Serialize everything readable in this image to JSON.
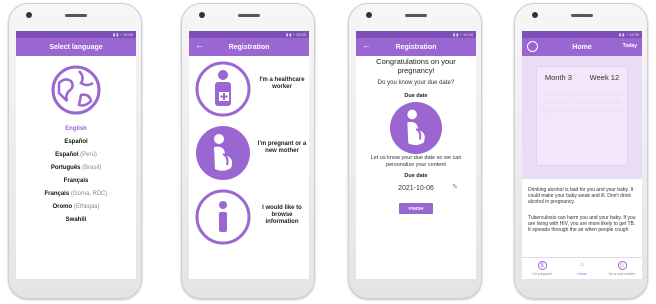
{
  "phone1": {
    "title": "Select language",
    "languages": [
      {
        "name": "English",
        "region": "",
        "selected": true
      },
      {
        "name": "Español",
        "region": ""
      },
      {
        "name": "Español",
        "region": "(Perú)"
      },
      {
        "name": "Português",
        "region": "(Brasil)"
      },
      {
        "name": "Français",
        "region": ""
      },
      {
        "name": "Français",
        "region": "(Goma, RDC)"
      },
      {
        "name": "Oromo",
        "region": "(Ethiopia)"
      },
      {
        "name": "Swahili",
        "region": ""
      }
    ]
  },
  "phone2": {
    "title": "Registration",
    "back": "←",
    "options": [
      {
        "label": "I'm a healthcare worker",
        "icon": "healthcare-worker-icon"
      },
      {
        "label": "I'm pregnant or a new mother",
        "icon": "pregnant-mother-icon"
      },
      {
        "label": "I would like to browse information",
        "icon": "info-icon"
      }
    ]
  },
  "phone3": {
    "title": "Registration",
    "back": "←",
    "congrats": "Congratulations on your pregnancy!",
    "question": "Do you know your due date?",
    "due_heading": "Due date",
    "let_us_know": "Let us know your due date so we can personalize your content",
    "due_label": "Due date",
    "due_value": "2021-10-06",
    "finish": "FINISH"
  },
  "phone4": {
    "title": "Home",
    "today": "Today",
    "month": "Month 3",
    "week": "Week 12",
    "baby_text": "Your baby is about the size of a lime! He can close his fingers and curl his toes now.",
    "para1": "Drinking alcohol is bad for you and your baby. It could make your baby weak and ill. Don't drink alcohol in pregnancy.",
    "para2": "Tuberculosis can harm you and your baby. If you are living with HIV, you are more likely to get TB. It spreads through the air when people cough",
    "nav": [
      {
        "label": "I'm pregnant",
        "icon": "$"
      },
      {
        "label": "Home",
        "icon": "⌂"
      },
      {
        "label": "I'm a new mother",
        "icon": "☺"
      }
    ]
  },
  "colors": {
    "primary": "#9a66d2",
    "status_bar": "#7e4fb8",
    "light": "#eadcf6"
  }
}
